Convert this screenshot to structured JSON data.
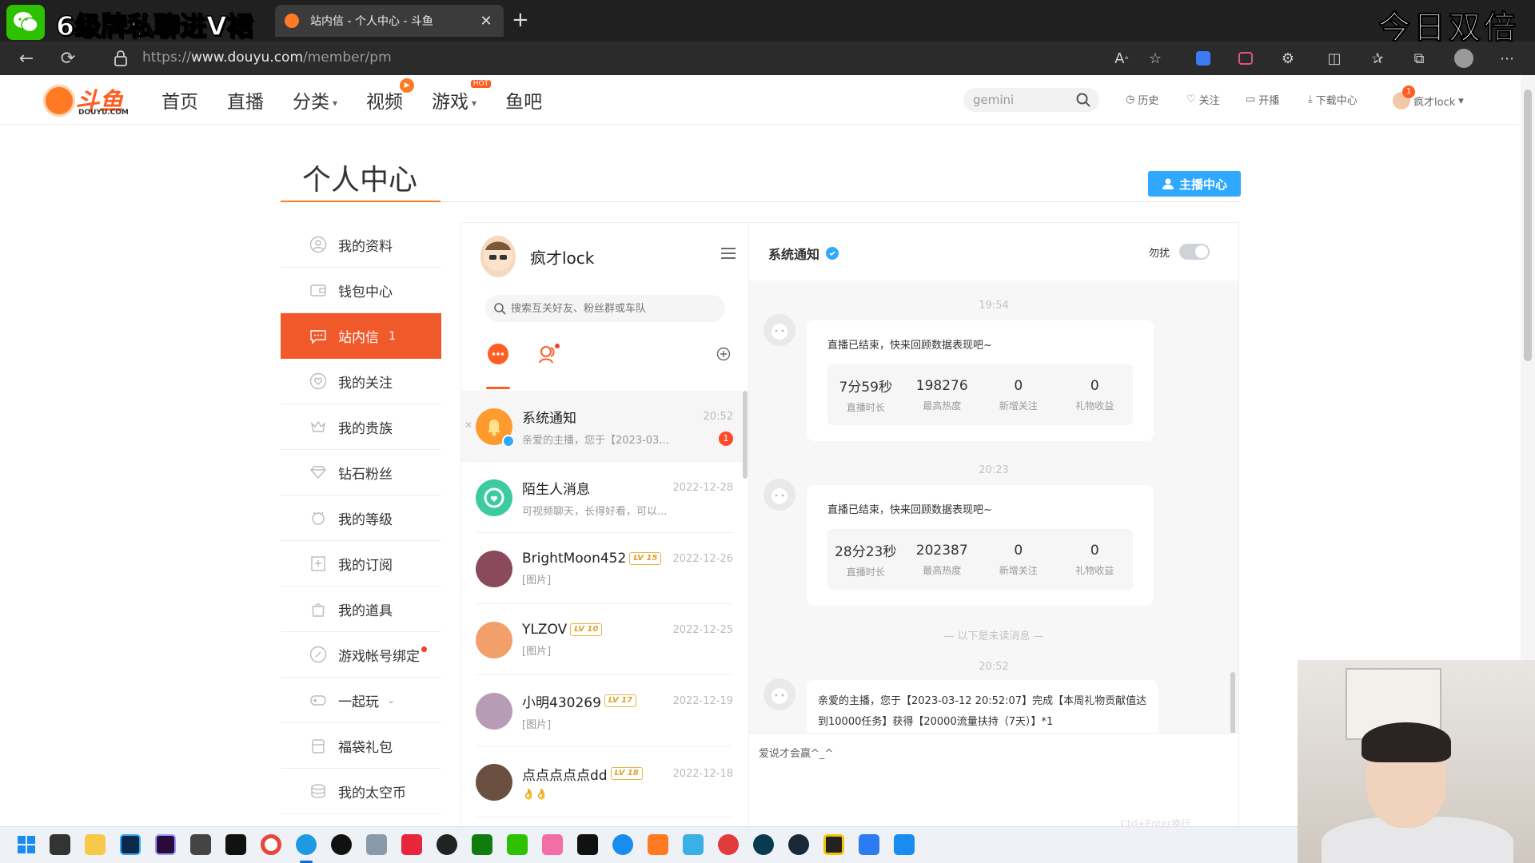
{
  "overlay": {
    "stream_title": "6级牌私聊进V裙",
    "corner_title": "今日双倍"
  },
  "browser": {
    "tab_title": "站内信 - 个人中心 - 斗鱼",
    "url_prefix": "https://",
    "url_host": "www.douyu.com",
    "url_path": "/member/pm"
  },
  "site": {
    "logo_text": "斗鱼",
    "logo_sub": "DOUYU.COM",
    "nav": [
      {
        "label": "首页"
      },
      {
        "label": "直播"
      },
      {
        "label": "分类"
      },
      {
        "label": "视频"
      },
      {
        "label": "游戏",
        "badge": "HOT"
      },
      {
        "label": "鱼吧"
      }
    ],
    "search_value": "gemini",
    "header_links": {
      "history": "历史",
      "follow": "关注",
      "broadcast": "开播",
      "download": "下载中心",
      "user": "疯才lock",
      "user_badge": "1"
    }
  },
  "page": {
    "title": "个人中心",
    "anchor_center": "主播中心"
  },
  "sidebar": {
    "items": [
      {
        "label": "我的资料",
        "icon": "user-icon"
      },
      {
        "label": "钱包中心",
        "icon": "wallet-icon"
      },
      {
        "label": "站内信",
        "icon": "message-icon",
        "count": "1",
        "active": true
      },
      {
        "label": "我的关注",
        "icon": "heart-icon"
      },
      {
        "label": "我的贵族",
        "icon": "crown-icon"
      },
      {
        "label": "钻石粉丝",
        "icon": "diamond-icon"
      },
      {
        "label": "我的等级",
        "icon": "level-icon"
      },
      {
        "label": "我的订阅",
        "icon": "subscribe-icon"
      },
      {
        "label": "我的道具",
        "icon": "bag-icon"
      },
      {
        "label": "游戏帐号绑定",
        "icon": "link-icon"
      },
      {
        "label": "一起玩",
        "icon": "gamepad-icon"
      },
      {
        "label": "福袋礼包",
        "icon": "gift-icon"
      },
      {
        "label": "我的太空币",
        "icon": "coin-icon"
      }
    ]
  },
  "conversations": {
    "me_name": "疯才lock",
    "search_placeholder": "搜索互关好友、粉丝群或车队",
    "items": [
      {
        "name": "系统通知",
        "time": "20:52",
        "preview": "亲爱的主播，您于【2023-03...",
        "unread": "1",
        "avatar_color": "#ff9a2e"
      },
      {
        "name": "陌生人消息",
        "time": "2022-12-28",
        "preview": "可视频聊天，长得好看，可以...",
        "avatar_color": "#3ccaa0"
      },
      {
        "name": "BrightMoon452",
        "lv": "LV 15",
        "time": "2022-12-26",
        "preview": "[图片]",
        "avatar_color": "#8a4a5c"
      },
      {
        "name": "YLZOV",
        "lv": "LV 10",
        "time": "2022-12-25",
        "preview": "[图片]",
        "avatar_color": "#f2a06a"
      },
      {
        "name": "小明430269",
        "lv": "LV 17",
        "time": "2022-12-19",
        "preview": "[图片]",
        "avatar_color": "#b89cb6"
      },
      {
        "name": "点点点点点dd",
        "lv": "LV 18",
        "time": "2022-12-18",
        "preview": "👌👌",
        "avatar_color": "#6a5040"
      }
    ]
  },
  "chat": {
    "title": "系统通知",
    "dnd_label": "勿扰",
    "messages": [
      {
        "time": "19:54",
        "text": "直播已结束，快来回顾数据表现吧~",
        "stats": [
          {
            "value": "7分59秒",
            "label": "直播时长"
          },
          {
            "value": "198276",
            "label": "最高热度"
          },
          {
            "value": "0",
            "label": "新增关注"
          },
          {
            "value": "0",
            "label": "礼物收益"
          }
        ]
      },
      {
        "time": "20:23",
        "text": "直播已结束，快来回顾数据表现吧~",
        "stats": [
          {
            "value": "28分23秒",
            "label": "直播时长"
          },
          {
            "value": "202387",
            "label": "最高热度"
          },
          {
            "value": "0",
            "label": "新增关注"
          },
          {
            "value": "0",
            "label": "礼物收益"
          }
        ]
      }
    ],
    "unread_divider": "— 以下是未读消息 —",
    "last_time": "20:52",
    "last_message": "亲爱的主播，您于【2023-03-12 20:52:07】完成【本周礼物贡献值达到10000任务】获得【20000流量扶持（7天）】*1",
    "input_placeholder": "爱说才会赢^_^",
    "send_hint": "Ctrl+Enter换行"
  }
}
